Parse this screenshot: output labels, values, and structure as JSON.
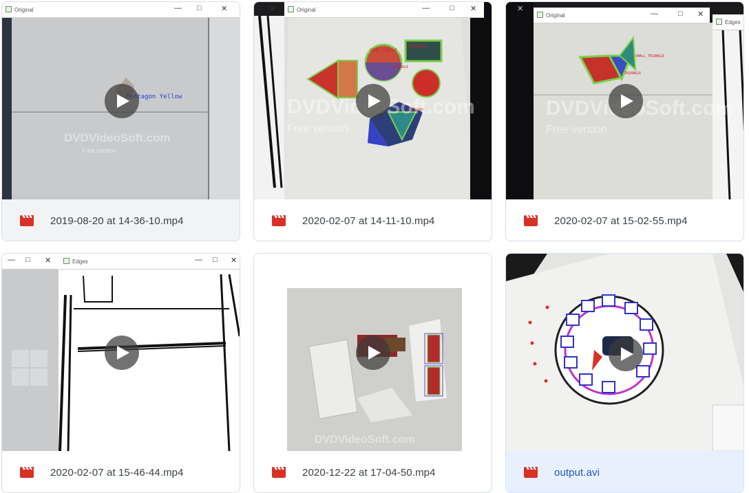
{
  "files": [
    {
      "name": "2019-08-20 at 14-36-10.mp4",
      "state": "hover",
      "thumb": {
        "window_title": "Original",
        "label": "Pentagon Yellow",
        "watermark": "DVDVideoSoft.com",
        "watermark_sub": "Free version"
      }
    },
    {
      "name": "2020-02-07 at 14-11-10.mp4",
      "state": "normal",
      "thumb": {
        "window_title": "Original",
        "watermark": "DVDVideoSoft.com",
        "watermark_sub": "Free version",
        "shape_labels": [
          "SEMI_CIRCLE",
          "RECTANGLE",
          "CIRCLE",
          "TRIANGLE",
          "HEXAGON"
        ]
      }
    },
    {
      "name": "2020-02-07 at 15-02-55.mp4",
      "state": "normal",
      "thumb": {
        "window_title": "Original",
        "window_title_2": "Edges",
        "watermark": "DVDVideoSoft.com",
        "watermark_sub": "Free version",
        "shape_labels": [
          "SMALL_TRIANGLE",
          "TRIANGLE"
        ]
      }
    },
    {
      "name": "2020-02-07 at 15-46-44.mp4",
      "state": "normal",
      "thumb": {
        "window_title": "Edges"
      }
    },
    {
      "name": "2020-12-22 at 17-04-50.mp4",
      "state": "normal",
      "thumb": {
        "watermark": "DVDVideoSoft.com"
      }
    },
    {
      "name": "output.avi",
      "state": "selected",
      "thumb": {}
    }
  ],
  "icons": {
    "file_type": "video-file-icon",
    "play": "play-icon"
  },
  "colors": {
    "file_icon": "#d93025",
    "selected_bg": "#e8f0fe",
    "selected_text": "#1a56c4",
    "hover_bg": "#f1f3f4"
  }
}
